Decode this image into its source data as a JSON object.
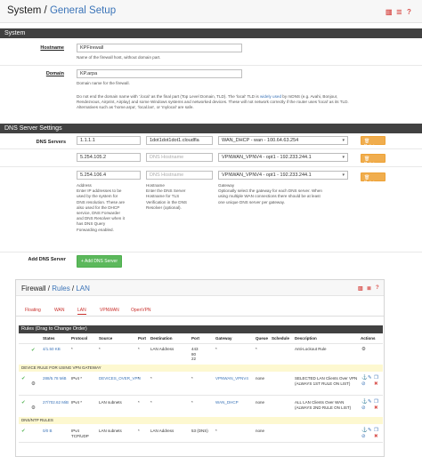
{
  "general": {
    "breadcrumb_root": "System",
    "breadcrumb_sep": " / ",
    "breadcrumb_page": "General Setup",
    "system_header": "System",
    "hostname_label": "Hostname",
    "hostname_value": "KPFirewall",
    "hostname_help": "Name of the firewall host, without domain part.",
    "domain_label": "Domain",
    "domain_value": "KP.arpa",
    "domain_help_1": "Domain name for the firewall.",
    "domain_help_2": "Do not end the domain name with '.local' as the final part (Top Level Domain, TLD). The 'local' TLD is",
    "domain_help_2_link": "widely used",
    "domain_help_2b": "by mDNS (e.g. Avahi, Bonjour,",
    "domain_help_3": "Rendezvous, Airprint, Airplay) and some Windows systems and networked devices. These will not network correctly if the router uses 'local' as its TLD.",
    "domain_help_4": "Alternatives such as 'home.arpa', 'local.lan', or 'mylocal' are safe.",
    "dns_header": "DNS Server Settings",
    "dns_servers_label": "DNS Servers",
    "dns_rows": [
      {
        "ip": "1.1.1.1",
        "hostname": "1dot1dot1dot1.cloudfla",
        "hostname_ph": false,
        "gateway": "WAN_DHCP - wan - 100.64.63.254"
      },
      {
        "ip": "5.254.105.2",
        "hostname": "DNS Hostname",
        "hostname_ph": true,
        "gateway": "VPNWAN_VPNV4 - opt1 - 192.233.244.1"
      },
      {
        "ip": "5.254.106.4",
        "hostname": "DNS Hostname",
        "hostname_ph": true,
        "gateway": "VPNWAN_VPNV4 - opt1 - 192.233.244.1"
      }
    ],
    "delete_label": "Delete",
    "help_address_title": "Address",
    "help_address": [
      "Enter IP addresses to be",
      "used by the system for",
      "DNS resolution. These are",
      "also used for the DHCP",
      "service, DNS Forwarder",
      "and DNS Resolver when it",
      "has DNS Query",
      "Forwarding enabled."
    ],
    "help_hostname_title": "Hostname",
    "help_hostname": [
      "Enter the DNS Server",
      "Hostname for TLS",
      "Verification in the DNS",
      "Resolver (optional)."
    ],
    "help_gateway_title": "Gateway",
    "help_gateway": [
      "Optionally select the gateway for each DNS server. When",
      "using multiple WAN connections there should be at least",
      "one unique DNS server per gateway."
    ],
    "add_dns_label": "Add DNS Server",
    "add_dns_button": "+ Add DNS Server"
  },
  "firewall": {
    "breadcrumb_a": "Firewall",
    "breadcrumb_b": "Rules",
    "breadcrumb_c": "LAN",
    "tabs": [
      "Floating",
      "WAN",
      "LAN",
      "VPNWAN",
      "OpenVPN"
    ],
    "active_tab": "LAN",
    "rules_header": "Rules (Drag to Change Order)",
    "columns": [
      "States",
      "Protocol",
      "Source",
      "Port",
      "Destination",
      "Port",
      "Gateway",
      "Queue",
      "Schedule",
      "Description",
      "Actions"
    ],
    "rules": [
      {
        "states": [
          "4/1.50 KB",
          ""
        ],
        "protocol": "*",
        "source": "*",
        "port": "*",
        "destination": "LAN Address",
        "dport": "443\n80\n22",
        "gateway": "*",
        "queue": "*",
        "schedule": "",
        "description": "Anti-Lockout Rule"
      }
    ],
    "separator1": "DEVICE RULE FOR USING VPN GATEWAY",
    "vpn_rules": [
      {
        "states": "288/5.78 MiB",
        "protocol": "IPv4 *",
        "source": "DEVICES_OVER_VPN",
        "port": "*",
        "destination": "*",
        "dport": "*",
        "gateway": "VPNWAN_VPNV4",
        "queue": "none",
        "description": "SELECTED LAN Clients Over VPN (ALWAYS 1ST RULE ON LIST)"
      },
      {
        "states": "27/702.62 MiB",
        "protocol": "IPv4 *",
        "source": "LAN subnets",
        "port": "*",
        "destination": "*",
        "dport": "*",
        "gateway": "WAN_DHCP",
        "queue": "none",
        "description": "ALL LAN Clients Over WAN (ALWAYS 2ND RULE ON LIST)"
      }
    ],
    "separator2": "DNS/NTP RULES",
    "dns_rules": [
      {
        "states": "0/0 B",
        "protocol": "IPv4 TCP/UDP",
        "source": "LAN subnets",
        "port": "*",
        "destination": "LAN Address",
        "dport": "53 (DNS)",
        "gateway": "*",
        "queue": "none",
        "description": ""
      }
    ]
  }
}
